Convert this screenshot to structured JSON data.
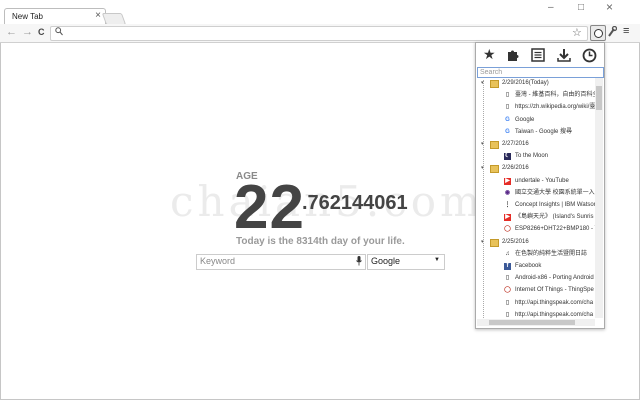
{
  "tab": {
    "title": "New Tab",
    "close": "×"
  },
  "window": {
    "minimize": "–",
    "maximize": "□",
    "close": "×"
  },
  "toolbar": {
    "back": "←",
    "forward": "→",
    "reload": "C",
    "search_glyph": "🔍",
    "star": "☆",
    "wrench": "🔧",
    "menu": "≡"
  },
  "main": {
    "age_label": "AGE",
    "age_int": "22",
    "age_decimal": ".762144061",
    "day_text": "Today is the 8314th day of your life.",
    "keyword_placeholder": "Keyword",
    "engine": "Google",
    "watermark": "chaian5.com"
  },
  "popup": {
    "icons": [
      "star-icon",
      "puzzle-icon",
      "document-icon",
      "download-icon",
      "clock-icon"
    ],
    "search_placeholder": "Search",
    "groups": [
      {
        "date": "2/29/2016(Today)",
        "items": [
          {
            "icon": "page",
            "text": "臺灣 - 維基百科，自由的百科全"
          },
          {
            "icon": "page",
            "text": "https://zh.wikipedia.org/wiki/臺"
          },
          {
            "icon": "google",
            "text": "Google"
          },
          {
            "icon": "google",
            "text": "Taiwan - Google 搜尋"
          }
        ]
      },
      {
        "date": "2/27/2016",
        "items": [
          {
            "icon": "moon",
            "text": "To the Moon"
          }
        ]
      },
      {
        "date": "2/26/2016",
        "items": [
          {
            "icon": "youtube",
            "text": "undertale - YouTube"
          },
          {
            "icon": "nctu",
            "text": "國立交通大學 校園系統單一入"
          },
          {
            "icon": "ibm",
            "text": "Concept Insights | IBM Watson"
          },
          {
            "icon": "youtube",
            "text": "《島嶼天光》 (Island's Sunris"
          },
          {
            "icon": "thingspeak",
            "text": "ESP8266+DHT22+BMP180 - T"
          }
        ]
      },
      {
        "date": "2/25/2016",
        "items": [
          {
            "icon": "headset",
            "text": "在色製的純粹生活暨開日誌"
          },
          {
            "icon": "facebook",
            "text": "Facebook"
          },
          {
            "icon": "page",
            "text": "Android-x86 - Porting Android"
          },
          {
            "icon": "thingspeak",
            "text": "Internet Of Things - ThingSpe"
          },
          {
            "icon": "page",
            "text": "http://api.thingspeak.com/cha"
          },
          {
            "icon": "page",
            "text": "http://api.thingspeak.com/cha"
          }
        ]
      }
    ]
  },
  "colors": {
    "folder": "#e8c25a",
    "youtube": "#e52d27",
    "facebook": "#3b5998",
    "accent": "#7aa0d8"
  }
}
